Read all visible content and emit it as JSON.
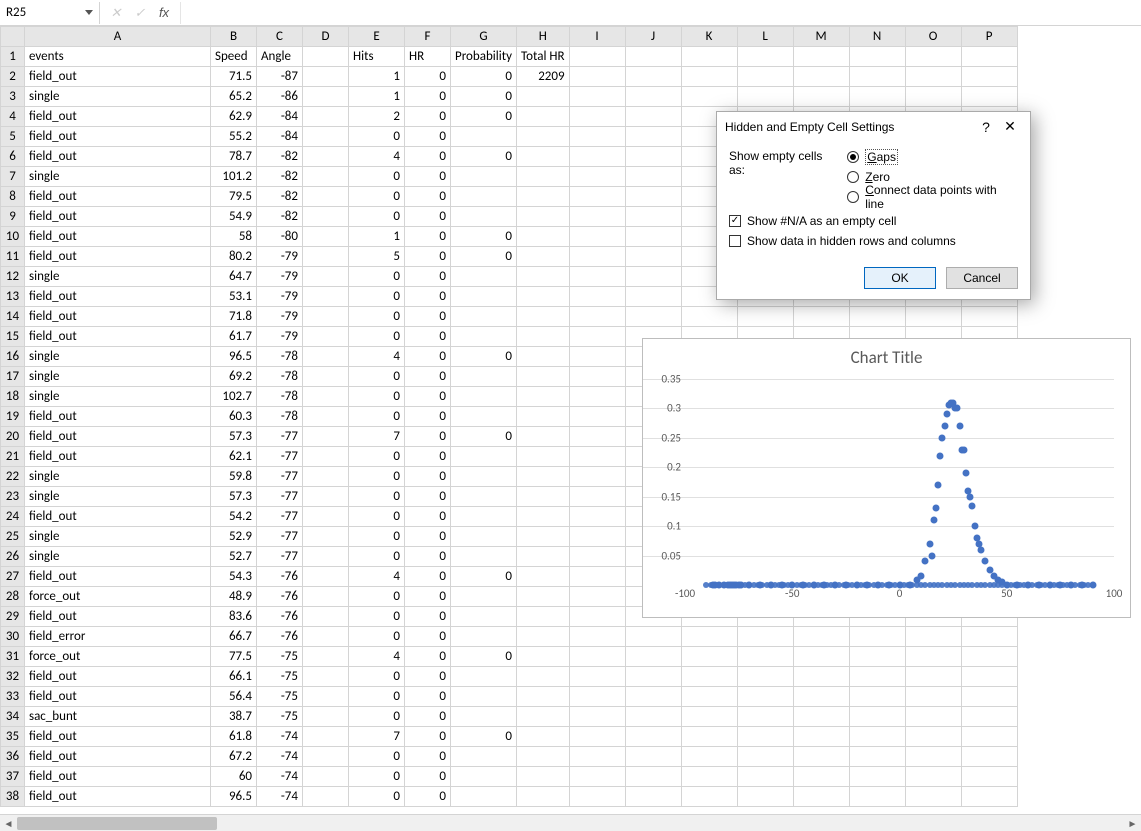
{
  "name_box": {
    "ref": "R25"
  },
  "fx": {
    "cancel": "✕",
    "enter": "✓",
    "fx": "fx"
  },
  "columns": [
    "A",
    "B",
    "C",
    "D",
    "E",
    "F",
    "G",
    "H",
    "I",
    "J",
    "K",
    "L",
    "M",
    "N",
    "O",
    "P"
  ],
  "headers": {
    "A": "events",
    "B": "Speed",
    "C": "Angle",
    "D": "",
    "E": "Hits",
    "F": "HR",
    "G": "Probability",
    "H": "Total HR"
  },
  "total_hr": "2209",
  "rows": [
    {
      "n": 2,
      "A": "field_out",
      "B": "71.5",
      "C": "-87",
      "E": "1",
      "F": "0",
      "G": "0"
    },
    {
      "n": 3,
      "A": "single",
      "B": "65.2",
      "C": "-86",
      "E": "1",
      "F": "0",
      "G": "0"
    },
    {
      "n": 4,
      "A": "field_out",
      "B": "62.9",
      "C": "-84",
      "E": "2",
      "F": "0",
      "G": "0"
    },
    {
      "n": 5,
      "A": "field_out",
      "B": "55.2",
      "C": "-84",
      "E": "0",
      "F": "0",
      "G": ""
    },
    {
      "n": 6,
      "A": "field_out",
      "B": "78.7",
      "C": "-82",
      "E": "4",
      "F": "0",
      "G": "0"
    },
    {
      "n": 7,
      "A": "single",
      "B": "101.2",
      "C": "-82",
      "E": "0",
      "F": "0",
      "G": ""
    },
    {
      "n": 8,
      "A": "field_out",
      "B": "79.5",
      "C": "-82",
      "E": "0",
      "F": "0",
      "G": ""
    },
    {
      "n": 9,
      "A": "field_out",
      "B": "54.9",
      "C": "-82",
      "E": "0",
      "F": "0",
      "G": ""
    },
    {
      "n": 10,
      "A": "field_out",
      "B": "58",
      "C": "-80",
      "E": "1",
      "F": "0",
      "G": "0"
    },
    {
      "n": 11,
      "A": "field_out",
      "B": "80.2",
      "C": "-79",
      "E": "5",
      "F": "0",
      "G": "0"
    },
    {
      "n": 12,
      "A": "single",
      "B": "64.7",
      "C": "-79",
      "E": "0",
      "F": "0",
      "G": ""
    },
    {
      "n": 13,
      "A": "field_out",
      "B": "53.1",
      "C": "-79",
      "E": "0",
      "F": "0",
      "G": ""
    },
    {
      "n": 14,
      "A": "field_out",
      "B": "71.8",
      "C": "-79",
      "E": "0",
      "F": "0",
      "G": ""
    },
    {
      "n": 15,
      "A": "field_out",
      "B": "61.7",
      "C": "-79",
      "E": "0",
      "F": "0",
      "G": ""
    },
    {
      "n": 16,
      "A": "single",
      "B": "96.5",
      "C": "-78",
      "E": "4",
      "F": "0",
      "G": "0"
    },
    {
      "n": 17,
      "A": "single",
      "B": "69.2",
      "C": "-78",
      "E": "0",
      "F": "0",
      "G": ""
    },
    {
      "n": 18,
      "A": "single",
      "B": "102.7",
      "C": "-78",
      "E": "0",
      "F": "0",
      "G": ""
    },
    {
      "n": 19,
      "A": "field_out",
      "B": "60.3",
      "C": "-78",
      "E": "0",
      "F": "0",
      "G": ""
    },
    {
      "n": 20,
      "A": "field_out",
      "B": "57.3",
      "C": "-77",
      "E": "7",
      "F": "0",
      "G": "0"
    },
    {
      "n": 21,
      "A": "field_out",
      "B": "62.1",
      "C": "-77",
      "E": "0",
      "F": "0",
      "G": ""
    },
    {
      "n": 22,
      "A": "single",
      "B": "59.8",
      "C": "-77",
      "E": "0",
      "F": "0",
      "G": ""
    },
    {
      "n": 23,
      "A": "single",
      "B": "57.3",
      "C": "-77",
      "E": "0",
      "F": "0",
      "G": ""
    },
    {
      "n": 24,
      "A": "field_out",
      "B": "54.2",
      "C": "-77",
      "E": "0",
      "F": "0",
      "G": ""
    },
    {
      "n": 25,
      "A": "single",
      "B": "52.9",
      "C": "-77",
      "E": "0",
      "F": "0",
      "G": ""
    },
    {
      "n": 26,
      "A": "single",
      "B": "52.7",
      "C": "-77",
      "E": "0",
      "F": "0",
      "G": ""
    },
    {
      "n": 27,
      "A": "field_out",
      "B": "54.3",
      "C": "-76",
      "E": "4",
      "F": "0",
      "G": "0"
    },
    {
      "n": 28,
      "A": "force_out",
      "B": "48.9",
      "C": "-76",
      "E": "0",
      "F": "0",
      "G": ""
    },
    {
      "n": 29,
      "A": "field_out",
      "B": "83.6",
      "C": "-76",
      "E": "0",
      "F": "0",
      "G": ""
    },
    {
      "n": 30,
      "A": "field_error",
      "B": "66.7",
      "C": "-76",
      "E": "0",
      "F": "0",
      "G": ""
    },
    {
      "n": 31,
      "A": "force_out",
      "B": "77.5",
      "C": "-75",
      "E": "4",
      "F": "0",
      "G": "0"
    },
    {
      "n": 32,
      "A": "field_out",
      "B": "66.1",
      "C": "-75",
      "E": "0",
      "F": "0",
      "G": ""
    },
    {
      "n": 33,
      "A": "field_out",
      "B": "56.4",
      "C": "-75",
      "E": "0",
      "F": "0",
      "G": ""
    },
    {
      "n": 34,
      "A": "sac_bunt",
      "B": "38.7",
      "C": "-75",
      "E": "0",
      "F": "0",
      "G": ""
    },
    {
      "n": 35,
      "A": "field_out",
      "B": "61.8",
      "C": "-74",
      "E": "7",
      "F": "0",
      "G": "0"
    },
    {
      "n": 36,
      "A": "field_out",
      "B": "67.2",
      "C": "-74",
      "E": "0",
      "F": "0",
      "G": ""
    },
    {
      "n": 37,
      "A": "field_out",
      "B": "60",
      "C": "-74",
      "E": "0",
      "F": "0",
      "G": ""
    },
    {
      "n": 38,
      "A": "field_out",
      "B": "96.5",
      "C": "-74",
      "E": "0",
      "F": "0",
      "G": ""
    }
  ],
  "dialog": {
    "title": "Hidden and Empty Cell Settings",
    "show_as_label": "Show empty cells as:",
    "opt_gaps": "Gaps",
    "opt_zero": "Zero",
    "opt_connect": "Connect data points with line",
    "chk_na": "Show #N/A as an empty cell",
    "chk_hidden": "Show data in hidden rows and columns",
    "ok": "OK",
    "cancel": "Cancel"
  },
  "chart": {
    "title": "Chart Title"
  },
  "chart_data": {
    "type": "scatter",
    "title": "Chart Title",
    "xlabel": "",
    "ylabel": "",
    "xlim": [
      -100,
      100
    ],
    "ylim": [
      0,
      0.35
    ],
    "xticks": [
      -100,
      -50,
      0,
      50,
      100
    ],
    "yticks": [
      0.05,
      0.1,
      0.15,
      0.2,
      0.25,
      0.3,
      0.35
    ],
    "series": [
      {
        "name": "Probability",
        "points": [
          {
            "x": -87,
            "y": 0
          },
          {
            "x": -86,
            "y": 0
          },
          {
            "x": -84,
            "y": 0
          },
          {
            "x": -82,
            "y": 0
          },
          {
            "x": -80,
            "y": 0
          },
          {
            "x": -79,
            "y": 0
          },
          {
            "x": -78,
            "y": 0
          },
          {
            "x": -77,
            "y": 0
          },
          {
            "x": -76,
            "y": 0
          },
          {
            "x": -75,
            "y": 0
          },
          {
            "x": -74,
            "y": 0
          },
          {
            "x": -70,
            "y": 0
          },
          {
            "x": -65,
            "y": 0
          },
          {
            "x": -60,
            "y": 0
          },
          {
            "x": -55,
            "y": 0
          },
          {
            "x": -50,
            "y": 0
          },
          {
            "x": -45,
            "y": 0
          },
          {
            "x": -40,
            "y": 0
          },
          {
            "x": -35,
            "y": 0
          },
          {
            "x": -30,
            "y": 0
          },
          {
            "x": -25,
            "y": 0
          },
          {
            "x": -20,
            "y": 0
          },
          {
            "x": -15,
            "y": 0
          },
          {
            "x": -10,
            "y": 0
          },
          {
            "x": -5,
            "y": 0
          },
          {
            "x": 0,
            "y": 0
          },
          {
            "x": 5,
            "y": 0
          },
          {
            "x": 8,
            "y": 0.008
          },
          {
            "x": 10,
            "y": 0.015
          },
          {
            "x": 12,
            "y": 0.04
          },
          {
            "x": 14,
            "y": 0.07
          },
          {
            "x": 15,
            "y": 0.05
          },
          {
            "x": 16,
            "y": 0.11
          },
          {
            "x": 17,
            "y": 0.13
          },
          {
            "x": 18,
            "y": 0.17
          },
          {
            "x": 19,
            "y": 0.22
          },
          {
            "x": 20,
            "y": 0.25
          },
          {
            "x": 21,
            "y": 0.27
          },
          {
            "x": 22,
            "y": 0.29
          },
          {
            "x": 23,
            "y": 0.305
          },
          {
            "x": 24,
            "y": 0.31
          },
          {
            "x": 25,
            "y": 0.31
          },
          {
            "x": 26,
            "y": 0.3
          },
          {
            "x": 27,
            "y": 0.3
          },
          {
            "x": 28,
            "y": 0.27
          },
          {
            "x": 29,
            "y": 0.23
          },
          {
            "x": 30,
            "y": 0.23
          },
          {
            "x": 31,
            "y": 0.19
          },
          {
            "x": 32,
            "y": 0.16
          },
          {
            "x": 33,
            "y": 0.15
          },
          {
            "x": 34,
            "y": 0.135
          },
          {
            "x": 35,
            "y": 0.1
          },
          {
            "x": 36,
            "y": 0.08
          },
          {
            "x": 37,
            "y": 0.07
          },
          {
            "x": 38,
            "y": 0.06
          },
          {
            "x": 40,
            "y": 0.04
          },
          {
            "x": 42,
            "y": 0.025
          },
          {
            "x": 44,
            "y": 0.015
          },
          {
            "x": 46,
            "y": 0.008
          },
          {
            "x": 48,
            "y": 0.005
          },
          {
            "x": 50,
            "y": 0
          },
          {
            "x": 55,
            "y": 0
          },
          {
            "x": 60,
            "y": 0
          },
          {
            "x": 65,
            "y": 0
          },
          {
            "x": 70,
            "y": 0
          },
          {
            "x": 75,
            "y": 0
          },
          {
            "x": 80,
            "y": 0
          },
          {
            "x": 85,
            "y": 0
          },
          {
            "x": 90,
            "y": 0
          }
        ]
      }
    ]
  }
}
